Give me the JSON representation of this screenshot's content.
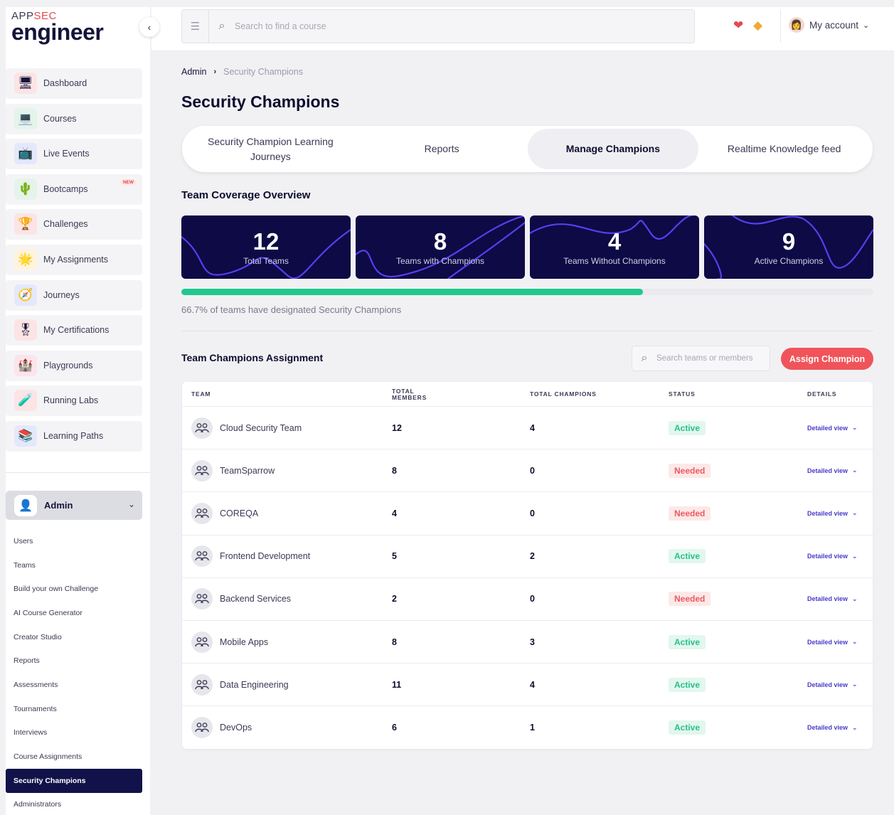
{
  "logo": {
    "line1a": "APP",
    "line1b": "SEC",
    "line2": "engineer"
  },
  "sidebar": {
    "items": [
      {
        "label": "Dashboard",
        "icon": "dashboard-icon",
        "glyph": "🖥",
        "bg": "#fce4e4"
      },
      {
        "label": "Courses",
        "icon": "courses-icon",
        "glyph": "💻",
        "bg": "#e4f4ea"
      },
      {
        "label": "Live Events",
        "icon": "live-events-icon",
        "glyph": "📺",
        "bg": "#e4e8fc"
      },
      {
        "label": "Bootcamps",
        "icon": "bootcamps-icon",
        "glyph": "🌵",
        "bg": "#e4f4ea",
        "badge": "NEW"
      },
      {
        "label": "Challenges",
        "icon": "challenges-icon",
        "glyph": "🏆",
        "bg": "#fce4e4"
      },
      {
        "label": "My Assignments",
        "icon": "assignments-icon",
        "glyph": "🌟",
        "bg": "#fff3dc"
      },
      {
        "label": "Journeys",
        "icon": "journeys-icon",
        "glyph": "🧭",
        "bg": "#e4e8fc"
      },
      {
        "label": "My Certifications",
        "icon": "certifications-icon",
        "glyph": "🎖",
        "bg": "#fce4e4"
      },
      {
        "label": "Playgrounds",
        "icon": "playgrounds-icon",
        "glyph": "🏰",
        "bg": "#fce4ec"
      },
      {
        "label": "Running Labs",
        "icon": "running-labs-icon",
        "glyph": "🧪",
        "bg": "#fce4e4"
      },
      {
        "label": "Learning Paths",
        "icon": "learning-paths-icon",
        "glyph": "📚",
        "bg": "#e4e8fc"
      }
    ],
    "admin": {
      "label": "Admin",
      "links": [
        "Users",
        "Teams",
        "Build your own Challenge",
        "AI Course Generator",
        "Creator Studio",
        "Reports",
        "Assessments",
        "Tournaments",
        "Interviews",
        "Course Assignments",
        "Security Champions",
        "Administrators"
      ],
      "active": "Security Champions"
    }
  },
  "header": {
    "search_placeholder": "Search to find a course",
    "account_label": "My account"
  },
  "breadcrumb": {
    "parent": "Admin",
    "current": "Security Champions"
  },
  "page_title": "Security Champions",
  "tabs": [
    {
      "label": "Security Champion Learning Journeys",
      "active": false
    },
    {
      "label": "Reports",
      "active": false
    },
    {
      "label": "Manage Champions",
      "active": true
    },
    {
      "label": "Realtime Knowledge feed",
      "active": false
    }
  ],
  "coverage": {
    "title": "Team Coverage Overview",
    "stats": [
      {
        "value": "12",
        "label": "Total Teams"
      },
      {
        "value": "8",
        "label": "Teams with Champions"
      },
      {
        "value": "4",
        "label": "Teams Without Champions"
      },
      {
        "value": "9",
        "label": "Active Champions"
      }
    ],
    "progress_percent": 66.7,
    "progress_text": "66.7% of teams have designated Security Champions"
  },
  "assignment": {
    "title": "Team Champions Assignment",
    "search_placeholder": "Search teams or members",
    "assign_label": "Assign Champion",
    "columns": [
      "TEAM",
      "TOTAL MEMBERS",
      "TOTAL CHAMPIONS",
      "STATUS",
      "DETAILS"
    ],
    "details_label": "Detailed view",
    "rows": [
      {
        "team": "Cloud Security Team",
        "members": "12",
        "champions": "4",
        "status": "Active"
      },
      {
        "team": "TeamSparrow",
        "members": "8",
        "champions": "0",
        "status": "Needed"
      },
      {
        "team": "COREQA",
        "members": "4",
        "champions": "0",
        "status": "Needed"
      },
      {
        "team": "Frontend Development",
        "members": "5",
        "champions": "2",
        "status": "Active"
      },
      {
        "team": "Backend Services",
        "members": "2",
        "champions": "0",
        "status": "Needed"
      },
      {
        "team": "Mobile Apps",
        "members": "8",
        "champions": "3",
        "status": "Active"
      },
      {
        "team": "Data Engineering",
        "members": "11",
        "champions": "4",
        "status": "Active"
      },
      {
        "team": "DevOps",
        "members": "6",
        "champions": "1",
        "status": "Active"
      }
    ]
  },
  "colors": {
    "accent_navy": "#0d0a45",
    "active_green": "#27c08a",
    "needed_red": "#ea5a5f",
    "assign_button": "#f0545a",
    "progress_green": "#1fc98e",
    "link_purple": "#4a3cc8"
  }
}
